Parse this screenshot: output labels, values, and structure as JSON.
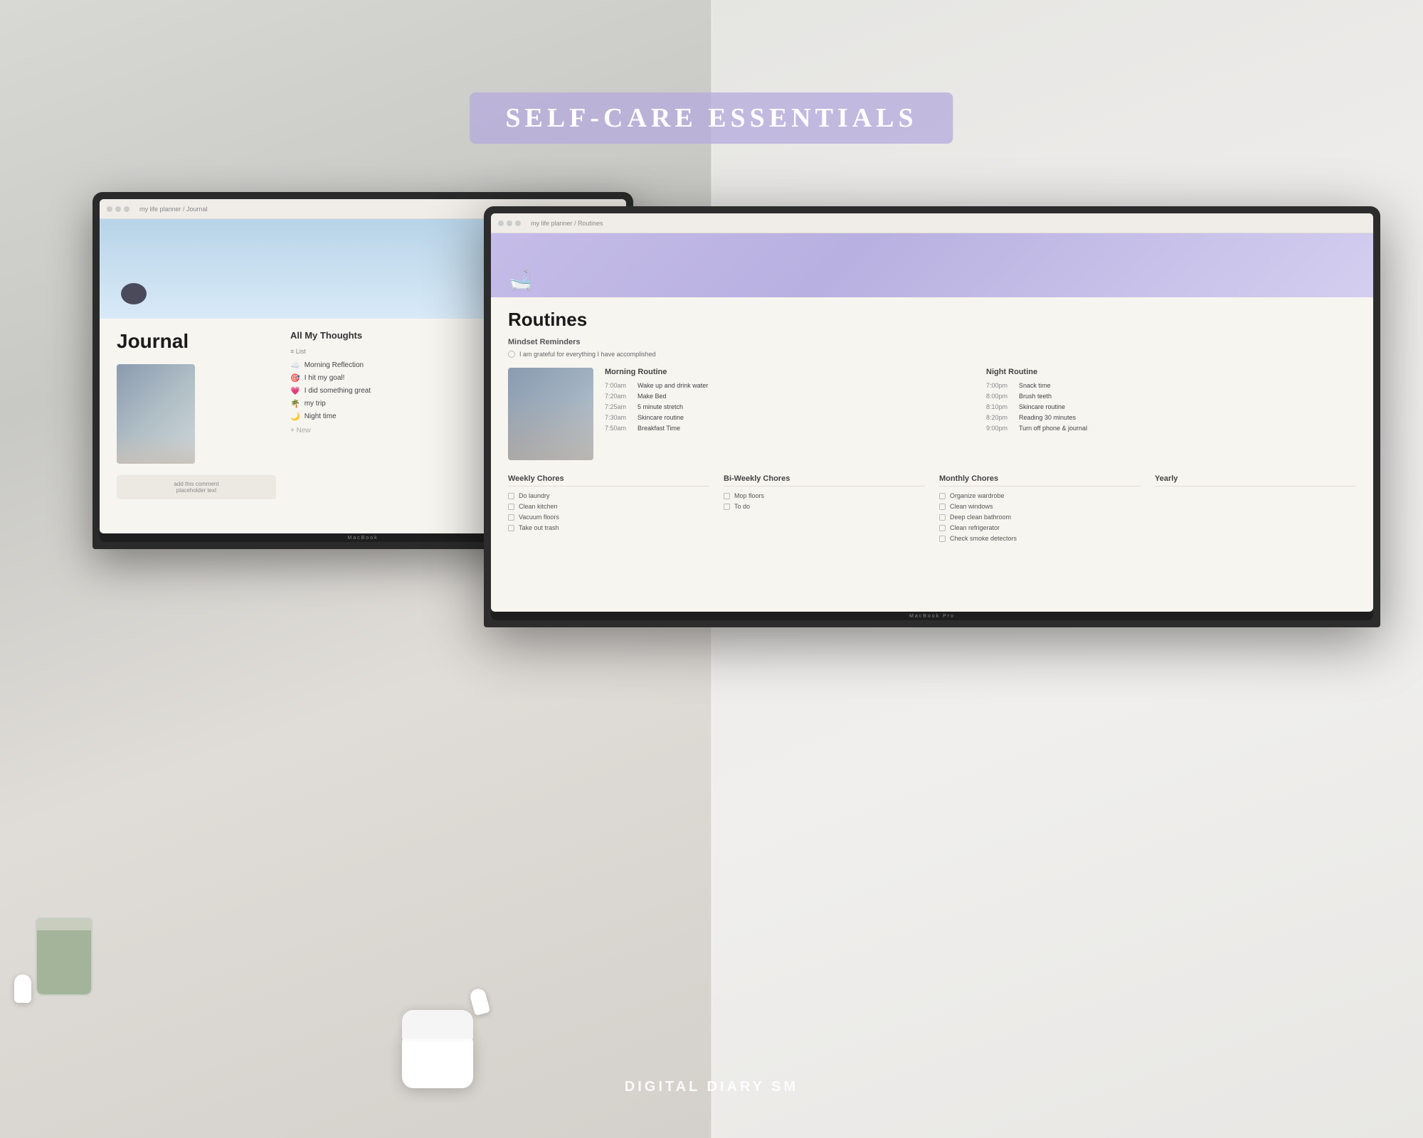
{
  "page": {
    "title": "Self-Care Essentials",
    "watermark": "Digital Diary SM"
  },
  "title_banner": {
    "text": "SELF-CARE ESSENTIALS",
    "bg_color": "rgba(180, 170, 220, 0.75)"
  },
  "left_laptop": {
    "label": "MacBook",
    "topbar": {
      "breadcrumb": "my life planner / Journal"
    },
    "page_title": "Journal",
    "thoughts_section": {
      "title": "All My Thoughts",
      "list_label": "≡ List",
      "items": [
        {
          "icon": "☁️",
          "text": "Morning Reflection"
        },
        {
          "icon": "🎯",
          "text": "I hit my goal!"
        },
        {
          "icon": "💗",
          "text": "I did something great"
        },
        {
          "icon": "🌴",
          "text": "my trip"
        },
        {
          "icon": "🌙",
          "text": "Night time"
        }
      ],
      "new_item_label": "+ New"
    }
  },
  "right_laptop": {
    "label": "MacBook Pro",
    "topbar": {
      "breadcrumb": "my life planner / Routines"
    },
    "cover_icon": "🛁",
    "page_title": "Routines",
    "mindset_section": {
      "label": "Mindset Reminders",
      "item": "I am grateful for everything I have accomplished"
    },
    "morning_routine": {
      "header": "Morning Routine",
      "items": [
        {
          "time": "7:00am",
          "task": "Wake up and drink water"
        },
        {
          "time": "7:20am",
          "task": "Make Bed"
        },
        {
          "time": "7:25am",
          "task": "5 minute stretch"
        },
        {
          "time": "7:30am",
          "task": "Skincare routine"
        },
        {
          "time": "7:50am",
          "task": "Breakfast Time"
        }
      ]
    },
    "night_routine": {
      "header": "Night Routine",
      "items": [
        {
          "time": "7:00pm",
          "task": "Snack time"
        },
        {
          "time": "8:00pm",
          "task": "Brush teeth"
        },
        {
          "time": "8:10pm",
          "task": "Skincare routine"
        },
        {
          "time": "8:20pm",
          "task": "Reading 30 minutes"
        },
        {
          "time": "9:00pm",
          "task": "Turn off phone & journal"
        }
      ]
    },
    "weekly_chores": {
      "header": "Weekly Chores",
      "items": [
        "Do laundry",
        "Clean kitchen",
        "Vacuum floors",
        "Take out trash"
      ]
    },
    "biweekly_chores": {
      "header": "Bi-Weekly Chores",
      "items": [
        "Mop floors",
        "To do"
      ]
    },
    "monthly_chores": {
      "header": "Monthly Chores",
      "items": [
        "Organize wardrobe",
        "Clean windows",
        "Deep clean bathroom",
        "Clean refrigerator",
        "Check smoke detectors"
      ]
    },
    "yearly_chores": {
      "header": "Yearly",
      "items": []
    }
  }
}
